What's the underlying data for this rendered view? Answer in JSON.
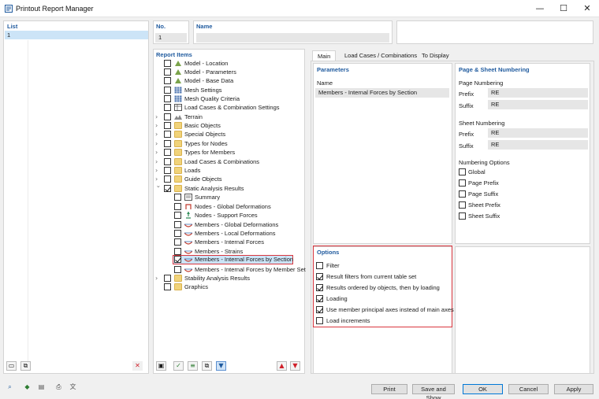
{
  "window": {
    "title": "Printout Report Manager",
    "minimize_glyph": "—",
    "maximize_glyph": "☐",
    "close_glyph": "✕"
  },
  "list": {
    "header": "List",
    "items": [
      "1"
    ]
  },
  "no": {
    "label": "No.",
    "value": "1"
  },
  "name": {
    "label": "Name",
    "value": ""
  },
  "report_items": {
    "header": "Report Items",
    "rows": [
      {
        "label": "Model - Location",
        "checked": false
      },
      {
        "label": "Model - Parameters",
        "checked": false
      },
      {
        "label": "Model - Base Data",
        "checked": false
      },
      {
        "label": "Mesh Settings",
        "checked": false
      },
      {
        "label": "Mesh Quality Criteria",
        "checked": false
      },
      {
        "label": "Load Cases & Combination Settings",
        "checked": false
      },
      {
        "label": "Terrain",
        "checked": false
      },
      {
        "label": "Basic Objects",
        "checked": false
      },
      {
        "label": "Special Objects",
        "checked": false
      },
      {
        "label": "Types for Nodes",
        "checked": false
      },
      {
        "label": "Types for Members",
        "checked": false
      },
      {
        "label": "Load Cases & Combinations",
        "checked": false
      },
      {
        "label": "Loads",
        "checked": false
      },
      {
        "label": "Guide Objects",
        "checked": false
      },
      {
        "label": "Static Analysis Results",
        "checked": true
      },
      {
        "label": "Summary",
        "checked": false
      },
      {
        "label": "Nodes - Global Deformations",
        "checked": false
      },
      {
        "label": "Nodes - Support Forces",
        "checked": false
      },
      {
        "label": "Members - Global Deformations",
        "checked": false
      },
      {
        "label": "Members - Local Deformations",
        "checked": false
      },
      {
        "label": "Members - Internal Forces",
        "checked": false
      },
      {
        "label": "Members - Strains",
        "checked": false
      },
      {
        "label": "Members - Internal Forces by Section",
        "checked": true,
        "selected": true
      },
      {
        "label": "Members - Internal Forces by Member Set",
        "checked": false
      },
      {
        "label": "Stability Analysis Results",
        "checked": false
      },
      {
        "label": "Graphics",
        "checked": false
      }
    ]
  },
  "tabs": [
    "Main",
    "Load Cases / Combinations",
    "To Display"
  ],
  "parameters": {
    "header": "Parameters",
    "name_label": "Name",
    "name_value": "Members - Internal Forces by Section"
  },
  "options": {
    "header": "Options",
    "items": [
      {
        "label": "Filter",
        "checked": false
      },
      {
        "label": "Result filters from current table set",
        "checked": true
      },
      {
        "label": "Results ordered by objects, then by loading",
        "checked": true
      },
      {
        "label": "Loading",
        "checked": true
      },
      {
        "label": "Use member principal axes instead of main axes",
        "checked": true
      },
      {
        "label": "Load increments",
        "checked": false
      }
    ]
  },
  "numbering": {
    "header": "Page & Sheet Numbering",
    "page_header": "Page Numbering",
    "page_prefix_label": "Prefix",
    "page_prefix_value": "RE",
    "page_suffix_label": "Suffix",
    "page_suffix_value": "RE",
    "sheet_header": "Sheet Numbering",
    "sheet_prefix_label": "Prefix",
    "sheet_prefix_value": "RE",
    "sheet_suffix_label": "Suffix",
    "sheet_suffix_value": "RE",
    "options_header": "Numbering Options",
    "options": [
      {
        "label": "Global",
        "checked": false
      },
      {
        "label": "Page Prefix",
        "checked": false
      },
      {
        "label": "Page Suffix",
        "checked": false
      },
      {
        "label": "Sheet Prefix",
        "checked": false
      },
      {
        "label": "Sheet Suffix",
        "checked": false
      }
    ]
  },
  "buttons": {
    "print": "Print",
    "save_and_show": "Save and Show",
    "ok": "OK",
    "cancel": "Cancel",
    "apply": "Apply"
  },
  "colors": {
    "accent": "#1f5a9e",
    "highlight_border": "#d9363e",
    "selection": "#cce4f7",
    "ok_border": "#0078d7"
  }
}
